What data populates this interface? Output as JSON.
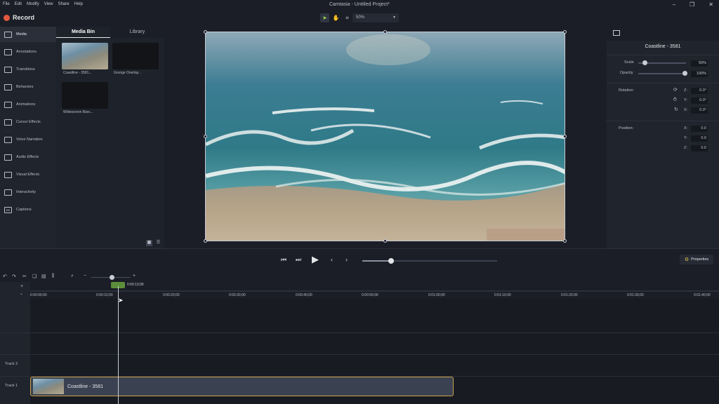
{
  "menu": [
    "File",
    "Edit",
    "Modify",
    "View",
    "Share",
    "Help"
  ],
  "app_title": "Camtasia - Untitled Project*",
  "window_controls": [
    "minimize",
    "restore",
    "close"
  ],
  "toolbar": {
    "record_label": "Record",
    "zoom_value": "50%"
  },
  "sidebar": {
    "items": [
      {
        "label": "Media",
        "icon": "film-icon"
      },
      {
        "label": "Annotations",
        "icon": "annotation-icon"
      },
      {
        "label": "Transitions",
        "icon": "transition-icon"
      },
      {
        "label": "Behaviors",
        "icon": "behavior-icon"
      },
      {
        "label": "Animations",
        "icon": "animation-icon"
      },
      {
        "label": "Cursor Effects",
        "icon": "cursor-icon"
      },
      {
        "label": "Voice Narration",
        "icon": "microphone-icon"
      },
      {
        "label": "Audio Effects",
        "icon": "speaker-icon"
      },
      {
        "label": "Visual Effects",
        "icon": "wand-icon"
      },
      {
        "label": "Interactivity",
        "icon": "interactivity-icon"
      },
      {
        "label": "Captions",
        "icon": "cc-icon"
      }
    ]
  },
  "media_bin": {
    "tabs": [
      "Media Bin",
      "Library"
    ],
    "items": [
      {
        "label": "Coastline - 3581..."
      },
      {
        "label": "Grunge Overlay..."
      },
      {
        "label": "Widescreen Bars..."
      }
    ]
  },
  "properties": {
    "title": "Coastline - 3581",
    "scale_label": "Scale",
    "scale_value": "50%",
    "opacity_label": "Opacity",
    "opacity_value": "100%",
    "rotation_label": "Rotation:",
    "rotation": {
      "z": "0.0°",
      "y": "0.0°",
      "x": "0.0°"
    },
    "position_label": "Position:",
    "position": {
      "x": "0.0",
      "y": "0.0",
      "z": "0.0"
    },
    "axis_labels": {
      "x": "X:",
      "y": "Y:",
      "z": "Z:"
    },
    "button_label": "Properties"
  },
  "timeline": {
    "playhead_time": "0:00:13;06",
    "ticks": [
      "0:00:00;00",
      "0:00:10;00",
      "0:00:20;00",
      "0:00:30;00",
      "0:00:40;00",
      "0:00:50;00",
      "0:01:00;00",
      "0:01:10;00",
      "0:01:20;00",
      "0:01:30;00",
      "0:01:40;00"
    ],
    "tracks": [
      "Track 2",
      "Track 1"
    ],
    "clip_label": "Coastline - 3581"
  }
}
